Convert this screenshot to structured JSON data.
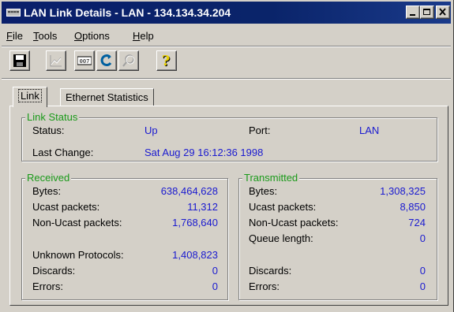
{
  "window": {
    "title": "LAN Link Details - LAN - 134.134.34.204",
    "icon_text": "===="
  },
  "menu": {
    "items": [
      {
        "key": "F",
        "rest": "ile"
      },
      {
        "key": "T",
        "rest": "ools"
      },
      {
        "key": "O",
        "rest": "ptions"
      },
      {
        "key": "H",
        "rest": "elp"
      }
    ]
  },
  "toolbar": {
    "buttons": [
      "save-icon",
      "chart-icon",
      "counter-icon",
      "refresh-icon",
      "search-icon",
      "help-icon"
    ],
    "counter_text": "007",
    "help_text": "?"
  },
  "tabs": [
    "Link",
    "Ethernet Statistics"
  ],
  "link_status": {
    "title": "Link Status",
    "status_label": "Status:",
    "status_value": "Up",
    "port_label": "Port:",
    "port_value": "LAN",
    "last_change_label": "Last Change:",
    "last_change_value": "Sat Aug 29 16:12:36 1998"
  },
  "received": {
    "title": "Received",
    "rows": [
      {
        "label": "Bytes:",
        "value": "638,464,628"
      },
      {
        "label": "Ucast packets:",
        "value": "11,312"
      },
      {
        "label": "Non-Ucast packets:",
        "value": "1,768,640"
      },
      {
        "label": "Unknown Protocols:",
        "value": "1,408,823"
      },
      {
        "label": "Discards:",
        "value": "0"
      },
      {
        "label": "Errors:",
        "value": "0"
      }
    ]
  },
  "transmitted": {
    "title": "Transmitted",
    "rows": [
      {
        "label": "Bytes:",
        "value": "1,308,325"
      },
      {
        "label": "Ucast packets:",
        "value": "8,850"
      },
      {
        "label": "Non-Ucast packets:",
        "value": "724"
      },
      {
        "label": "Queue length:",
        "value": "0"
      },
      {
        "label": "Discards:",
        "value": "0"
      },
      {
        "label": "Errors:",
        "value": "0"
      }
    ]
  }
}
